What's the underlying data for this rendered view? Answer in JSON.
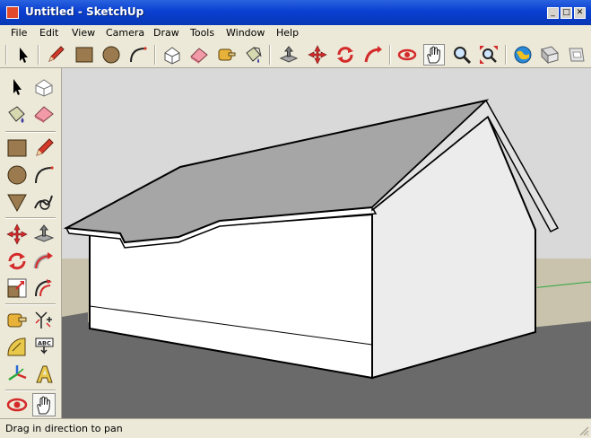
{
  "window": {
    "title": "Untitled - SketchUp",
    "controls": [
      "_",
      "□",
      "✕"
    ]
  },
  "menu": [
    "File",
    "Edit",
    "View",
    "Camera",
    "Draw",
    "Tools",
    "Window",
    "Help"
  ],
  "toolbar": {
    "active_tool": "pan",
    "items": [
      "select",
      "line",
      "rectangle",
      "circle",
      "arc",
      "make-component",
      "eraser",
      "tape-measure",
      "paint-bucket",
      "push-pull",
      "move",
      "rotate",
      "follow-me",
      "orbit",
      "pan",
      "zoom",
      "zoom-extents",
      "get-models",
      "share-model",
      "component-share"
    ]
  },
  "left_toolbar": {
    "active_tool": "pan",
    "items": [
      "select",
      "make-component",
      "paint-bucket",
      "eraser",
      "rectangle",
      "line",
      "circle",
      "arc",
      "polygon",
      "freehand",
      "move",
      "push-pull",
      "rotate",
      "follow-me",
      "scale",
      "offset",
      "tape-measure",
      "dimensions",
      "protractor",
      "text",
      "axes",
      "3d-text",
      "orbit",
      "pan"
    ]
  },
  "status": {
    "text": "Drag in direction to pan"
  },
  "colors": {
    "titlebar": "#0a3fd1",
    "sky": "#d9d9d9",
    "ground": "#c9c3ad",
    "floor": "#6a6a6a",
    "roof": "#a6a6a6",
    "wall": "#ffffff"
  }
}
